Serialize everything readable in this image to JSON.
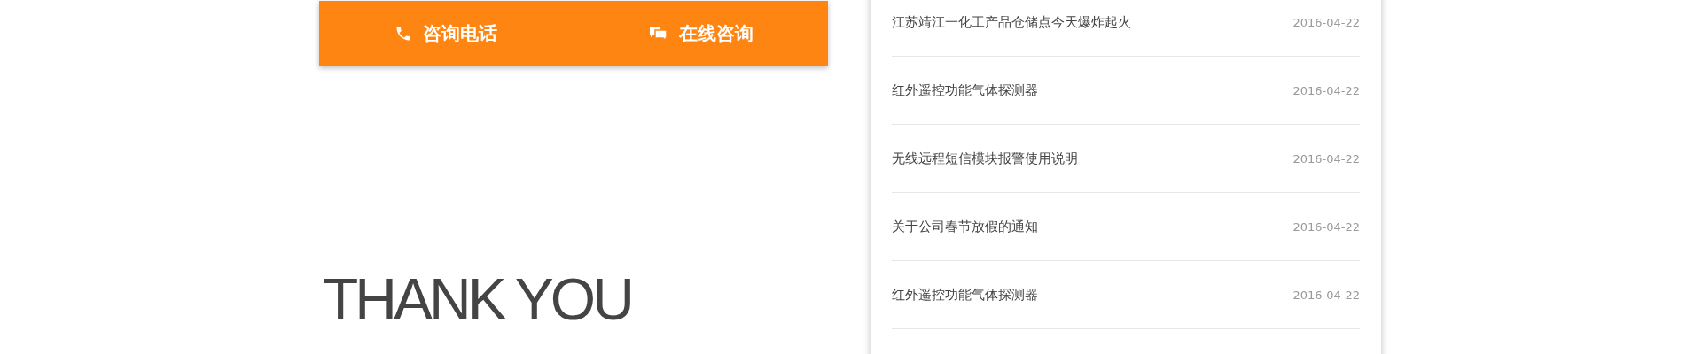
{
  "contact_bar": {
    "buttons": [
      {
        "kind": "phone",
        "label": "咨询电话"
      },
      {
        "kind": "chat",
        "label": "在线咨询"
      }
    ]
  },
  "closing": {
    "lines": [
      "THANK YOU"
    ]
  },
  "news": [
    {
      "title": "江苏靖江一化工产品仓储点今天爆炸起火",
      "date": "2016-04-22"
    },
    {
      "title": "红外遥控功能气体探测器",
      "date": "2016-04-22"
    },
    {
      "title": "无线远程短信模块报警使用说明",
      "date": "2016-04-22"
    },
    {
      "title": "关于公司春节放假的通知",
      "date": "2016-04-22"
    },
    {
      "title": "红外遥控功能气体探测器",
      "date": "2016-04-22"
    }
  ]
}
